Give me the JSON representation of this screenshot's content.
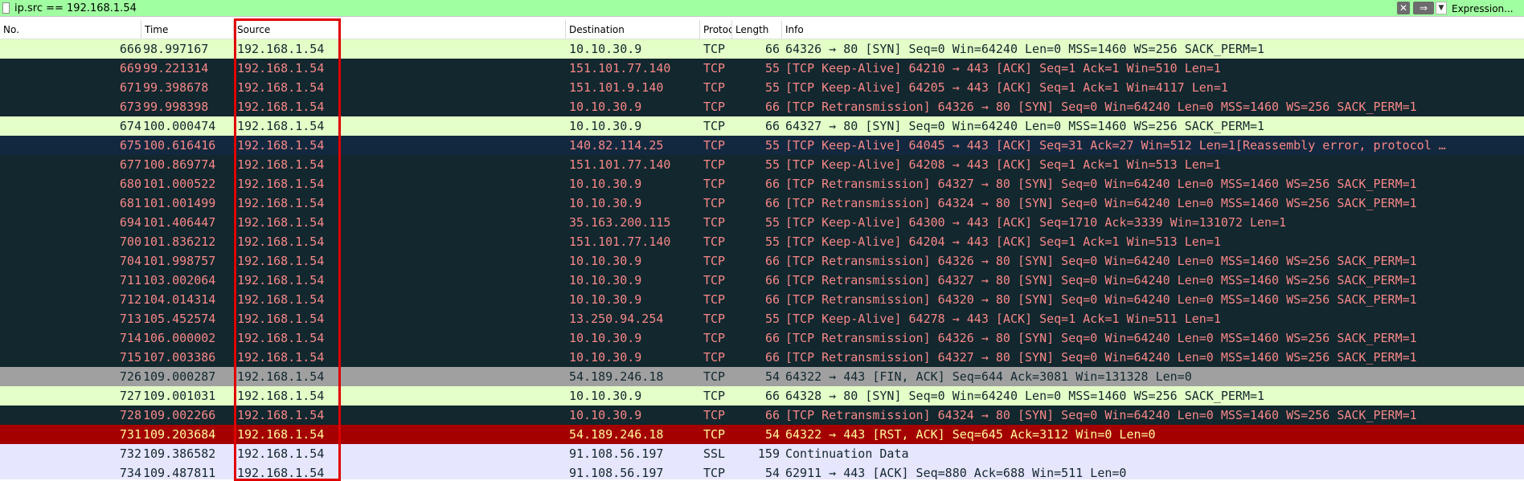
{
  "filter": {
    "value": "ip.src == 192.168.1.54",
    "clear_icon": "✕",
    "apply_icon": "⇒",
    "history_icon": "▼",
    "expression_label": "Expression..."
  },
  "columns": {
    "no": "No.",
    "time": "Time",
    "source": "Source",
    "destination": "Destination",
    "protocol": "Protocol",
    "length": "Length",
    "info": "Info"
  },
  "colors": {
    "filter_valid_bg": "#a0ffa0",
    "highlight_border": "#e00000",
    "syn_bg": "#e4ffc7",
    "bad_tcp_bg": "#12272e",
    "bad_tcp_fg": "#f78787",
    "fin_bg": "#a0a0a0",
    "rst_bg": "#a40000",
    "rst_fg": "#fffc9c",
    "ssl_bg": "#e7e6ff"
  },
  "packets": [
    {
      "no": "666",
      "time": "98.997167",
      "source": "192.168.1.54",
      "destination": "10.10.30.9",
      "protocol": "TCP",
      "length": "66",
      "info": "64326 → 80 [SYN] Seq=0 Win=64240 Len=0 MSS=1460 WS=256 SACK_PERM=1",
      "style": "syn"
    },
    {
      "no": "669",
      "time": "99.221314",
      "source": "192.168.1.54",
      "destination": "151.101.77.140",
      "protocol": "TCP",
      "length": "55",
      "info": "[TCP Keep-Alive] 64210 → 443 [ACK] Seq=1 Ack=1 Win=510 Len=1",
      "style": "bad"
    },
    {
      "no": "671",
      "time": "99.398678",
      "source": "192.168.1.54",
      "destination": "151.101.9.140",
      "protocol": "TCP",
      "length": "55",
      "info": "[TCP Keep-Alive] 64205 → 443 [ACK] Seq=1 Ack=1 Win=4117 Len=1",
      "style": "bad"
    },
    {
      "no": "673",
      "time": "99.998398",
      "source": "192.168.1.54",
      "destination": "10.10.30.9",
      "protocol": "TCP",
      "length": "66",
      "info": "[TCP Retransmission] 64326 → 80 [SYN] Seq=0 Win=64240 Len=0 MSS=1460 WS=256 SACK_PERM=1",
      "style": "bad"
    },
    {
      "no": "674",
      "time": "100.000474",
      "source": "192.168.1.54",
      "destination": "10.10.30.9",
      "protocol": "TCP",
      "length": "66",
      "info": "64327 → 80 [SYN] Seq=0 Win=64240 Len=0 MSS=1460 WS=256 SACK_PERM=1",
      "style": "syn"
    },
    {
      "no": "675",
      "time": "100.616416",
      "source": "192.168.1.54",
      "destination": "140.82.114.25",
      "protocol": "TCP",
      "length": "55",
      "info": "[TCP Keep-Alive] 64045 → 443 [ACK] Seq=31 Ack=27 Win=512 Len=1[Reassembly error, protocol …",
      "style": "err"
    },
    {
      "no": "677",
      "time": "100.869774",
      "source": "192.168.1.54",
      "destination": "151.101.77.140",
      "protocol": "TCP",
      "length": "55",
      "info": "[TCP Keep-Alive] 64208 → 443 [ACK] Seq=1 Ack=1 Win=513 Len=1",
      "style": "bad"
    },
    {
      "no": "680",
      "time": "101.000522",
      "source": "192.168.1.54",
      "destination": "10.10.30.9",
      "protocol": "TCP",
      "length": "66",
      "info": "[TCP Retransmission] 64327 → 80 [SYN] Seq=0 Win=64240 Len=0 MSS=1460 WS=256 SACK_PERM=1",
      "style": "bad"
    },
    {
      "no": "681",
      "time": "101.001499",
      "source": "192.168.1.54",
      "destination": "10.10.30.9",
      "protocol": "TCP",
      "length": "66",
      "info": "[TCP Retransmission] 64324 → 80 [SYN] Seq=0 Win=64240 Len=0 MSS=1460 WS=256 SACK_PERM=1",
      "style": "bad"
    },
    {
      "no": "694",
      "time": "101.406447",
      "source": "192.168.1.54",
      "destination": "35.163.200.115",
      "protocol": "TCP",
      "length": "55",
      "info": "[TCP Keep-Alive] 64300 → 443 [ACK] Seq=1710 Ack=3339 Win=131072 Len=1",
      "style": "bad"
    },
    {
      "no": "700",
      "time": "101.836212",
      "source": "192.168.1.54",
      "destination": "151.101.77.140",
      "protocol": "TCP",
      "length": "55",
      "info": "[TCP Keep-Alive] 64204 → 443 [ACK] Seq=1 Ack=1 Win=513 Len=1",
      "style": "bad"
    },
    {
      "no": "704",
      "time": "101.998757",
      "source": "192.168.1.54",
      "destination": "10.10.30.9",
      "protocol": "TCP",
      "length": "66",
      "info": "[TCP Retransmission] 64326 → 80 [SYN] Seq=0 Win=64240 Len=0 MSS=1460 WS=256 SACK_PERM=1",
      "style": "bad"
    },
    {
      "no": "711",
      "time": "103.002064",
      "source": "192.168.1.54",
      "destination": "10.10.30.9",
      "protocol": "TCP",
      "length": "66",
      "info": "[TCP Retransmission] 64327 → 80 [SYN] Seq=0 Win=64240 Len=0 MSS=1460 WS=256 SACK_PERM=1",
      "style": "bad"
    },
    {
      "no": "712",
      "time": "104.014314",
      "source": "192.168.1.54",
      "destination": "10.10.30.9",
      "protocol": "TCP",
      "length": "66",
      "info": "[TCP Retransmission] 64320 → 80 [SYN] Seq=0 Win=64240 Len=0 MSS=1460 WS=256 SACK_PERM=1",
      "style": "bad"
    },
    {
      "no": "713",
      "time": "105.452574",
      "source": "192.168.1.54",
      "destination": "13.250.94.254",
      "protocol": "TCP",
      "length": "55",
      "info": "[TCP Keep-Alive] 64278 → 443 [ACK] Seq=1 Ack=1 Win=511 Len=1",
      "style": "bad"
    },
    {
      "no": "714",
      "time": "106.000002",
      "source": "192.168.1.54",
      "destination": "10.10.30.9",
      "protocol": "TCP",
      "length": "66",
      "info": "[TCP Retransmission] 64326 → 80 [SYN] Seq=0 Win=64240 Len=0 MSS=1460 WS=256 SACK_PERM=1",
      "style": "bad"
    },
    {
      "no": "715",
      "time": "107.003386",
      "source": "192.168.1.54",
      "destination": "10.10.30.9",
      "protocol": "TCP",
      "length": "66",
      "info": "[TCP Retransmission] 64327 → 80 [SYN] Seq=0 Win=64240 Len=0 MSS=1460 WS=256 SACK_PERM=1",
      "style": "bad"
    },
    {
      "no": "726",
      "time": "109.000287",
      "source": "192.168.1.54",
      "destination": "54.189.246.18",
      "protocol": "TCP",
      "length": "54",
      "info": "64322 → 443 [FIN, ACK] Seq=644 Ack=3081 Win=131328 Len=0",
      "style": "fin"
    },
    {
      "no": "727",
      "time": "109.001031",
      "source": "192.168.1.54",
      "destination": "10.10.30.9",
      "protocol": "TCP",
      "length": "66",
      "info": "64328 → 80 [SYN] Seq=0 Win=64240 Len=0 MSS=1460 WS=256 SACK_PERM=1",
      "style": "syn"
    },
    {
      "no": "728",
      "time": "109.002266",
      "source": "192.168.1.54",
      "destination": "10.10.30.9",
      "protocol": "TCP",
      "length": "66",
      "info": "[TCP Retransmission] 64324 → 80 [SYN] Seq=0 Win=64240 Len=0 MSS=1460 WS=256 SACK_PERM=1",
      "style": "bad"
    },
    {
      "no": "731",
      "time": "109.203684",
      "source": "192.168.1.54",
      "destination": "54.189.246.18",
      "protocol": "TCP",
      "length": "54",
      "info": "64322 → 443 [RST, ACK] Seq=645 Ack=3112 Win=0 Len=0",
      "style": "rst"
    },
    {
      "no": "732",
      "time": "109.386582",
      "source": "192.168.1.54",
      "destination": "91.108.56.197",
      "protocol": "SSL",
      "length": "159",
      "info": "Continuation Data",
      "style": "ssl"
    },
    {
      "no": "734",
      "time": "109.487811",
      "source": "192.168.1.54",
      "destination": "91.108.56.197",
      "protocol": "TCP",
      "length": "54",
      "info": "62911 → 443 [ACK] Seq=880 Ack=688 Win=511 Len=0",
      "style": "ssl"
    }
  ]
}
